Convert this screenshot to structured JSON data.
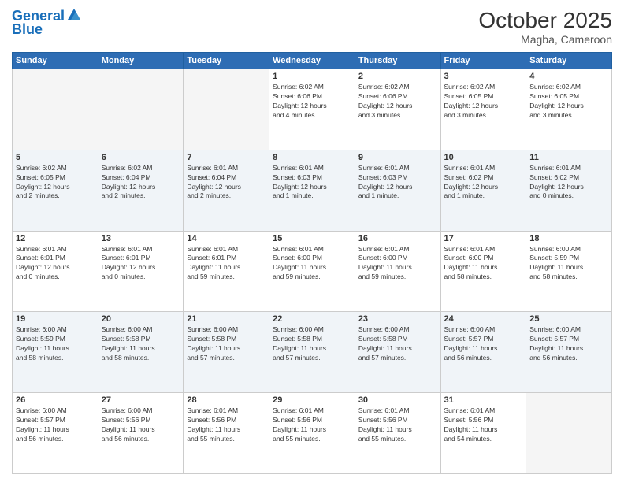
{
  "header": {
    "logo_line1": "General",
    "logo_line2": "Blue",
    "month_year": "October 2025",
    "location": "Magba, Cameroon"
  },
  "days_of_week": [
    "Sunday",
    "Monday",
    "Tuesday",
    "Wednesday",
    "Thursday",
    "Friday",
    "Saturday"
  ],
  "weeks": [
    {
      "days": [
        {
          "num": "",
          "info": ""
        },
        {
          "num": "",
          "info": ""
        },
        {
          "num": "",
          "info": ""
        },
        {
          "num": "1",
          "info": "Sunrise: 6:02 AM\nSunset: 6:06 PM\nDaylight: 12 hours\nand 4 minutes."
        },
        {
          "num": "2",
          "info": "Sunrise: 6:02 AM\nSunset: 6:06 PM\nDaylight: 12 hours\nand 3 minutes."
        },
        {
          "num": "3",
          "info": "Sunrise: 6:02 AM\nSunset: 6:05 PM\nDaylight: 12 hours\nand 3 minutes."
        },
        {
          "num": "4",
          "info": "Sunrise: 6:02 AM\nSunset: 6:05 PM\nDaylight: 12 hours\nand 3 minutes."
        }
      ]
    },
    {
      "days": [
        {
          "num": "5",
          "info": "Sunrise: 6:02 AM\nSunset: 6:05 PM\nDaylight: 12 hours\nand 2 minutes."
        },
        {
          "num": "6",
          "info": "Sunrise: 6:02 AM\nSunset: 6:04 PM\nDaylight: 12 hours\nand 2 minutes."
        },
        {
          "num": "7",
          "info": "Sunrise: 6:01 AM\nSunset: 6:04 PM\nDaylight: 12 hours\nand 2 minutes."
        },
        {
          "num": "8",
          "info": "Sunrise: 6:01 AM\nSunset: 6:03 PM\nDaylight: 12 hours\nand 1 minute."
        },
        {
          "num": "9",
          "info": "Sunrise: 6:01 AM\nSunset: 6:03 PM\nDaylight: 12 hours\nand 1 minute."
        },
        {
          "num": "10",
          "info": "Sunrise: 6:01 AM\nSunset: 6:02 PM\nDaylight: 12 hours\nand 1 minute."
        },
        {
          "num": "11",
          "info": "Sunrise: 6:01 AM\nSunset: 6:02 PM\nDaylight: 12 hours\nand 0 minutes."
        }
      ]
    },
    {
      "days": [
        {
          "num": "12",
          "info": "Sunrise: 6:01 AM\nSunset: 6:01 PM\nDaylight: 12 hours\nand 0 minutes."
        },
        {
          "num": "13",
          "info": "Sunrise: 6:01 AM\nSunset: 6:01 PM\nDaylight: 12 hours\nand 0 minutes."
        },
        {
          "num": "14",
          "info": "Sunrise: 6:01 AM\nSunset: 6:01 PM\nDaylight: 11 hours\nand 59 minutes."
        },
        {
          "num": "15",
          "info": "Sunrise: 6:01 AM\nSunset: 6:00 PM\nDaylight: 11 hours\nand 59 minutes."
        },
        {
          "num": "16",
          "info": "Sunrise: 6:01 AM\nSunset: 6:00 PM\nDaylight: 11 hours\nand 59 minutes."
        },
        {
          "num": "17",
          "info": "Sunrise: 6:01 AM\nSunset: 6:00 PM\nDaylight: 11 hours\nand 58 minutes."
        },
        {
          "num": "18",
          "info": "Sunrise: 6:00 AM\nSunset: 5:59 PM\nDaylight: 11 hours\nand 58 minutes."
        }
      ]
    },
    {
      "days": [
        {
          "num": "19",
          "info": "Sunrise: 6:00 AM\nSunset: 5:59 PM\nDaylight: 11 hours\nand 58 minutes."
        },
        {
          "num": "20",
          "info": "Sunrise: 6:00 AM\nSunset: 5:58 PM\nDaylight: 11 hours\nand 58 minutes."
        },
        {
          "num": "21",
          "info": "Sunrise: 6:00 AM\nSunset: 5:58 PM\nDaylight: 11 hours\nand 57 minutes."
        },
        {
          "num": "22",
          "info": "Sunrise: 6:00 AM\nSunset: 5:58 PM\nDaylight: 11 hours\nand 57 minutes."
        },
        {
          "num": "23",
          "info": "Sunrise: 6:00 AM\nSunset: 5:58 PM\nDaylight: 11 hours\nand 57 minutes."
        },
        {
          "num": "24",
          "info": "Sunrise: 6:00 AM\nSunset: 5:57 PM\nDaylight: 11 hours\nand 56 minutes."
        },
        {
          "num": "25",
          "info": "Sunrise: 6:00 AM\nSunset: 5:57 PM\nDaylight: 11 hours\nand 56 minutes."
        }
      ]
    },
    {
      "days": [
        {
          "num": "26",
          "info": "Sunrise: 6:00 AM\nSunset: 5:57 PM\nDaylight: 11 hours\nand 56 minutes."
        },
        {
          "num": "27",
          "info": "Sunrise: 6:00 AM\nSunset: 5:56 PM\nDaylight: 11 hours\nand 56 minutes."
        },
        {
          "num": "28",
          "info": "Sunrise: 6:01 AM\nSunset: 5:56 PM\nDaylight: 11 hours\nand 55 minutes."
        },
        {
          "num": "29",
          "info": "Sunrise: 6:01 AM\nSunset: 5:56 PM\nDaylight: 11 hours\nand 55 minutes."
        },
        {
          "num": "30",
          "info": "Sunrise: 6:01 AM\nSunset: 5:56 PM\nDaylight: 11 hours\nand 55 minutes."
        },
        {
          "num": "31",
          "info": "Sunrise: 6:01 AM\nSunset: 5:56 PM\nDaylight: 11 hours\nand 54 minutes."
        },
        {
          "num": "",
          "info": ""
        }
      ]
    }
  ]
}
